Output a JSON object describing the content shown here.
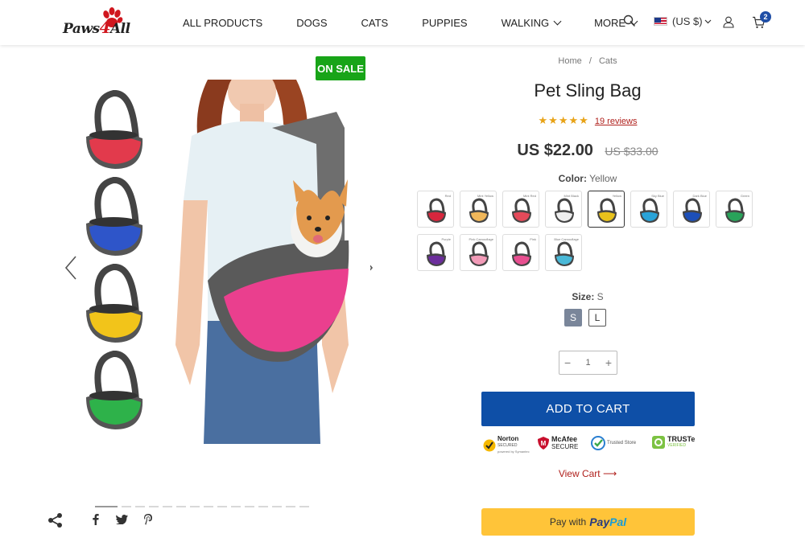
{
  "header": {
    "logo_text_left": "Paws",
    "logo_text_four": "4",
    "logo_text_right": "All",
    "nav": [
      {
        "label": "ALL PRODUCTS"
      },
      {
        "label": "DOGS"
      },
      {
        "label": "CATS"
      },
      {
        "label": "PUPPIES"
      },
      {
        "label": "WALKING"
      },
      {
        "label": "MORE"
      }
    ],
    "currency": "(US $)",
    "cart_count": "2"
  },
  "gallery": {
    "badge": "ON SALE",
    "thumbnail_colors": [
      "#e23a4c",
      "#2e55c9",
      "#f2c41a",
      "#2eb24a"
    ],
    "main_bag_color": "#ea3f8e",
    "dots_count": 15
  },
  "product": {
    "breadcrumb": {
      "home": "Home",
      "sep": "/",
      "category": "Cats"
    },
    "title": "Pet Sling Bag",
    "stars": "★★★★★",
    "reviews": "19 reviews",
    "price": "US $22.00",
    "compare_price": "US $33.00",
    "color_label": "Color:",
    "color_value": "Yellow",
    "swatches": [
      {
        "name": "Red",
        "color": "#d7263d"
      },
      {
        "name": "Mint Yellow",
        "color": "#f0b75a"
      },
      {
        "name": "Mint Red",
        "color": "#e44a5a"
      },
      {
        "name": "Mint Black",
        "color": "#eeeeee"
      },
      {
        "name": "Yellow",
        "color": "#e8c21c"
      },
      {
        "name": "Sky Blue",
        "color": "#2aa3d8"
      },
      {
        "name": "Dark Blue",
        "color": "#1d4fb8"
      },
      {
        "name": "Green",
        "color": "#29a35a"
      },
      {
        "name": "Purple",
        "color": "#6c2e9c"
      },
      {
        "name": "Pink Camouflage",
        "color": "#f29bb8"
      },
      {
        "name": "Pink",
        "color": "#e84f90"
      },
      {
        "name": "Blue Camouflage",
        "color": "#4ab9d8"
      }
    ],
    "size_label": "Size:",
    "size_value": "S",
    "sizes": [
      "S",
      "L"
    ],
    "qty_minus": "−",
    "quantity": "1",
    "qty_plus": "+",
    "add_to_cart": "ADD TO CART",
    "trust_badges": {
      "norton": "Norton",
      "norton_sub": "SECURED",
      "norton_powered": "powered by Symantec",
      "mcafee": "McAfee",
      "mcafee_sub": "SECURE",
      "trusted": "Trusted Store",
      "truste": "TRUSTe",
      "truste_sub": "VERIFIED"
    },
    "view_cart": "View Cart ⟶",
    "paypal_prefix": "Pay with",
    "paypal_brand_1": "Pay",
    "paypal_brand_2": "Pal"
  }
}
